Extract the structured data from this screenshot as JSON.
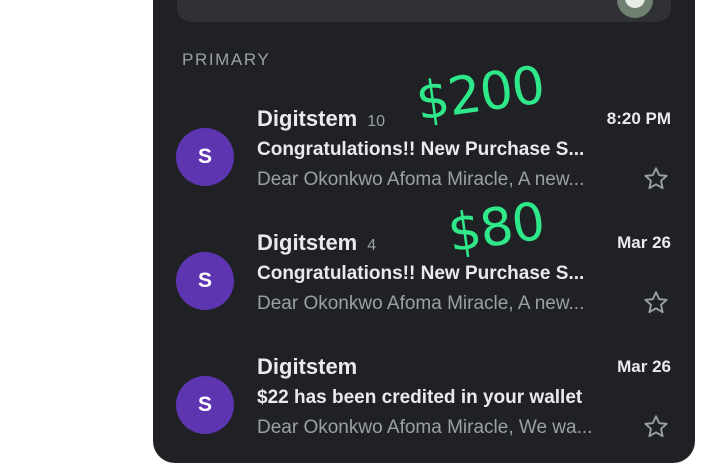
{
  "section_label": "PRIMARY",
  "emails": [
    {
      "avatar_letter": "S",
      "sender": "Digitstem",
      "count": "10",
      "time": "8:20 PM",
      "subject": "Congratulations!! New Purchase S...",
      "snippet": "Dear Okonkwo Afoma Miracle, A new...",
      "starred": false
    },
    {
      "avatar_letter": "S",
      "sender": "Digitstem",
      "count": "4",
      "time": "Mar 26",
      "subject": "Congratulations!! New Purchase S...",
      "snippet": "Dear Okonkwo Afoma Miracle, A new...",
      "starred": false
    },
    {
      "avatar_letter": "S",
      "sender": "Digitstem",
      "count": "",
      "time": "Mar 26",
      "subject": "$22 has been credited in your wallet",
      "snippet": "Dear Okonkwo Afoma Miracle, We wa...",
      "starred": false
    }
  ],
  "annotations": [
    "$200",
    "$80"
  ],
  "colors": {
    "background": "#202124",
    "avatar": "#5e35b1",
    "annotation": "#2ee88a",
    "primary_text": "#e8eaed",
    "secondary_text": "#9aa0a6"
  }
}
